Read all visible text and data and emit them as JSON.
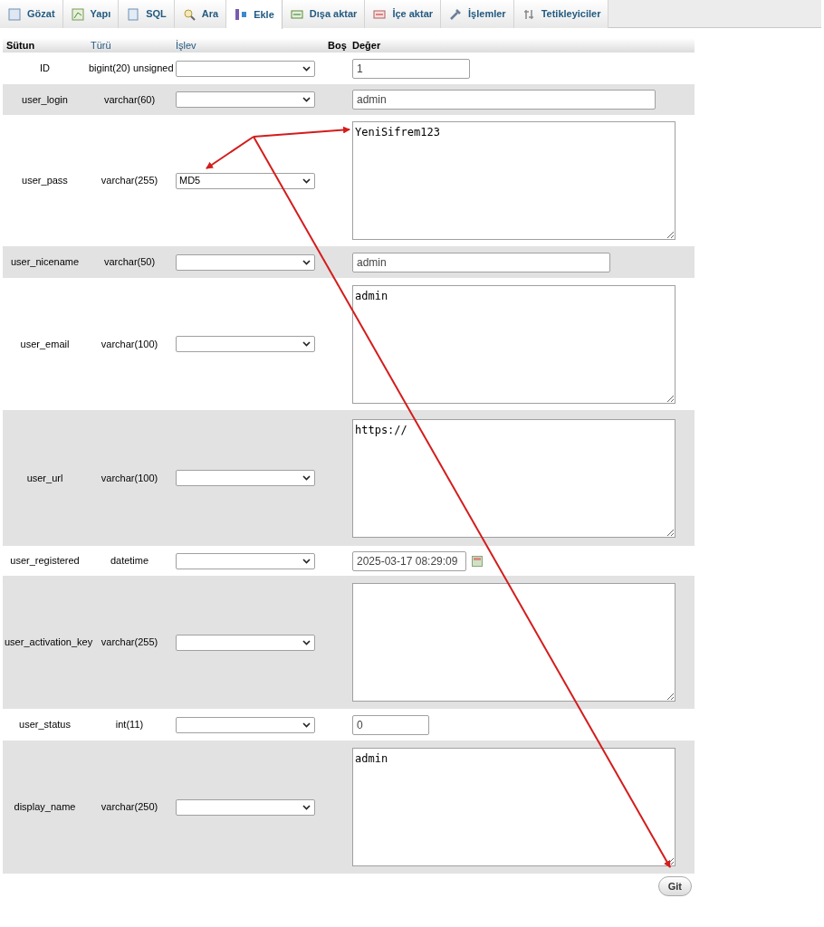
{
  "tabs": [
    {
      "label": "Gözat",
      "selected": false
    },
    {
      "label": "Yapı",
      "selected": false
    },
    {
      "label": "SQL",
      "selected": false
    },
    {
      "label": "Ara",
      "selected": false
    },
    {
      "label": "Ekle",
      "selected": true
    },
    {
      "label": "Dışa aktar",
      "selected": false
    },
    {
      "label": "İçe aktar",
      "selected": false
    },
    {
      "label": "İşlemler",
      "selected": false
    },
    {
      "label": "Tetikleyiciler",
      "selected": false
    }
  ],
  "table": {
    "columns": [
      {
        "label": "Sütun",
        "link": false
      },
      {
        "label": "Türü",
        "link": true
      },
      {
        "label": "İşlev",
        "link": true
      },
      {
        "label": "Boş",
        "link": false
      },
      {
        "label": "Değer",
        "link": false
      }
    ],
    "rows": [
      {
        "column": "ID",
        "type": "bigint(20) unsigned",
        "kind": "input",
        "value": "1"
      },
      {
        "column": "user_login",
        "type": "varchar(60)",
        "kind": "input",
        "value": "admin"
      },
      {
        "column": "user_pass",
        "type": "varchar(255)",
        "function": "MD5",
        "kind": "textarea",
        "value": "YeniSifrem123"
      },
      {
        "column": "user_nicename",
        "type": "varchar(50)",
        "kind": "input",
        "value": "admin"
      },
      {
        "column": "user_email",
        "type": "varchar(100)",
        "kind": "textarea",
        "value": "admin"
      },
      {
        "column": "user_url",
        "type": "varchar(100)",
        "kind": "textarea",
        "value": "https://"
      },
      {
        "column": "user_registered",
        "type": "datetime",
        "kind": "date",
        "value": "2025-03-17 08:29:09"
      },
      {
        "column": "user_activation_key",
        "type": "varchar(255)",
        "kind": "textarea"
      },
      {
        "column": "user_status",
        "type": "int(11)",
        "kind": "input",
        "value": "0"
      },
      {
        "column": "display_name",
        "type": "varchar(250)",
        "kind": "textarea",
        "value": "admin"
      }
    ]
  },
  "submit_button": "Git"
}
